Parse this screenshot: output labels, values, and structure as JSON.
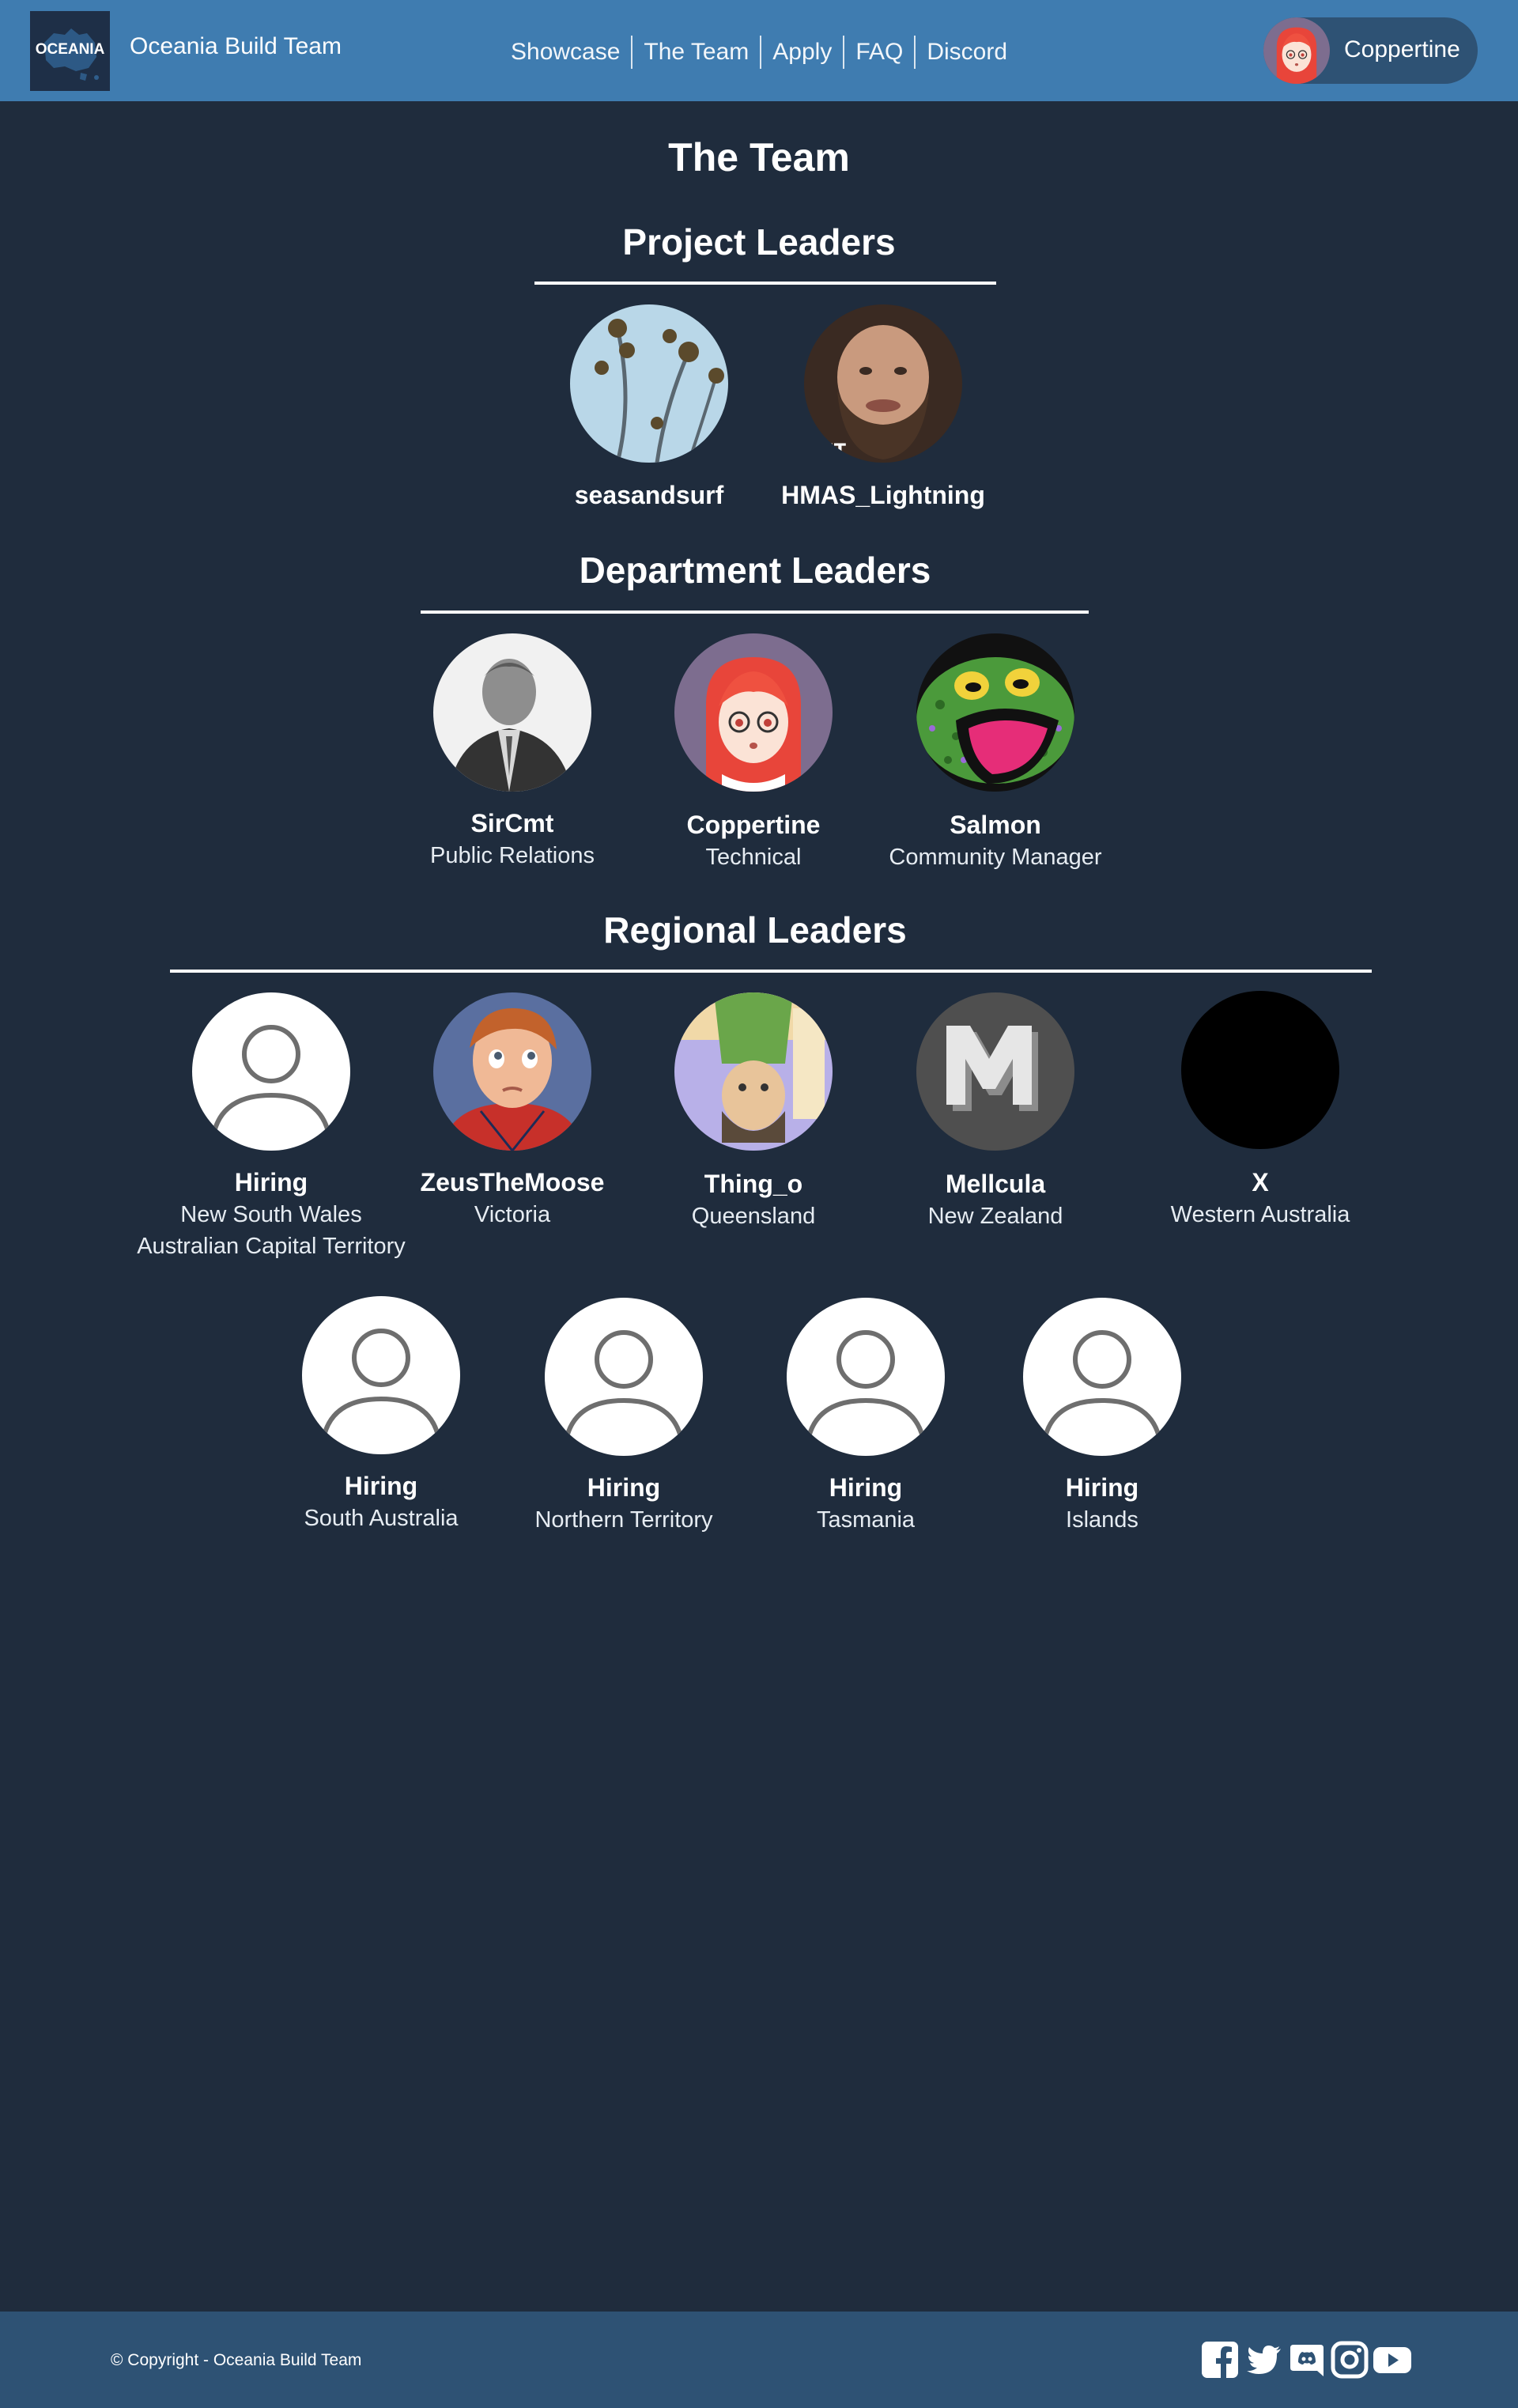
{
  "header": {
    "logo_text": "OCEANIA",
    "site_name": "Oceania Build Team",
    "nav": [
      {
        "label": "Showcase"
      },
      {
        "label": "The Team"
      },
      {
        "label": "Apply"
      },
      {
        "label": "FAQ"
      },
      {
        "label": "Discord"
      }
    ],
    "user": {
      "name": "Coppertine"
    }
  },
  "page": {
    "title": "The Team",
    "sections": [
      {
        "title": "Project Leaders",
        "members": [
          {
            "name": "seasandsurf",
            "role": ""
          },
          {
            "name": "HMAS_Lightning",
            "role": ""
          }
        ]
      },
      {
        "title": "Department Leaders",
        "members": [
          {
            "name": "SirCmt",
            "role": "Public Relations"
          },
          {
            "name": "Coppertine",
            "role": "Technical"
          },
          {
            "name": "Salmon",
            "role": "Community Manager"
          }
        ]
      },
      {
        "title": "Regional Leaders",
        "members": [
          {
            "name": "Hiring",
            "role": "New South Wales",
            "role2": "Australian Capital Territory"
          },
          {
            "name": "ZeusTheMoose",
            "role": "Victoria"
          },
          {
            "name": "Thing_o",
            "role": "Queensland"
          },
          {
            "name": "Mellcula",
            "role": "New Zealand"
          },
          {
            "name": "X",
            "role": "Western Australia"
          },
          {
            "name": "Hiring",
            "role": "South Australia"
          },
          {
            "name": "Hiring",
            "role": "Northern Territory"
          },
          {
            "name": "Hiring",
            "role": "Tasmania"
          },
          {
            "name": "Hiring",
            "role": "Islands"
          }
        ]
      }
    ]
  },
  "footer": {
    "copyright": "© Copyright - Oceania Build Team",
    "socials": [
      "facebook-icon",
      "twitter-icon",
      "discord-icon",
      "instagram-icon",
      "youtube-icon"
    ]
  },
  "colors": {
    "background": "#1f2c3d",
    "header": "#3f7cb0",
    "footer": "#2e5274",
    "text": "#ffffff"
  }
}
